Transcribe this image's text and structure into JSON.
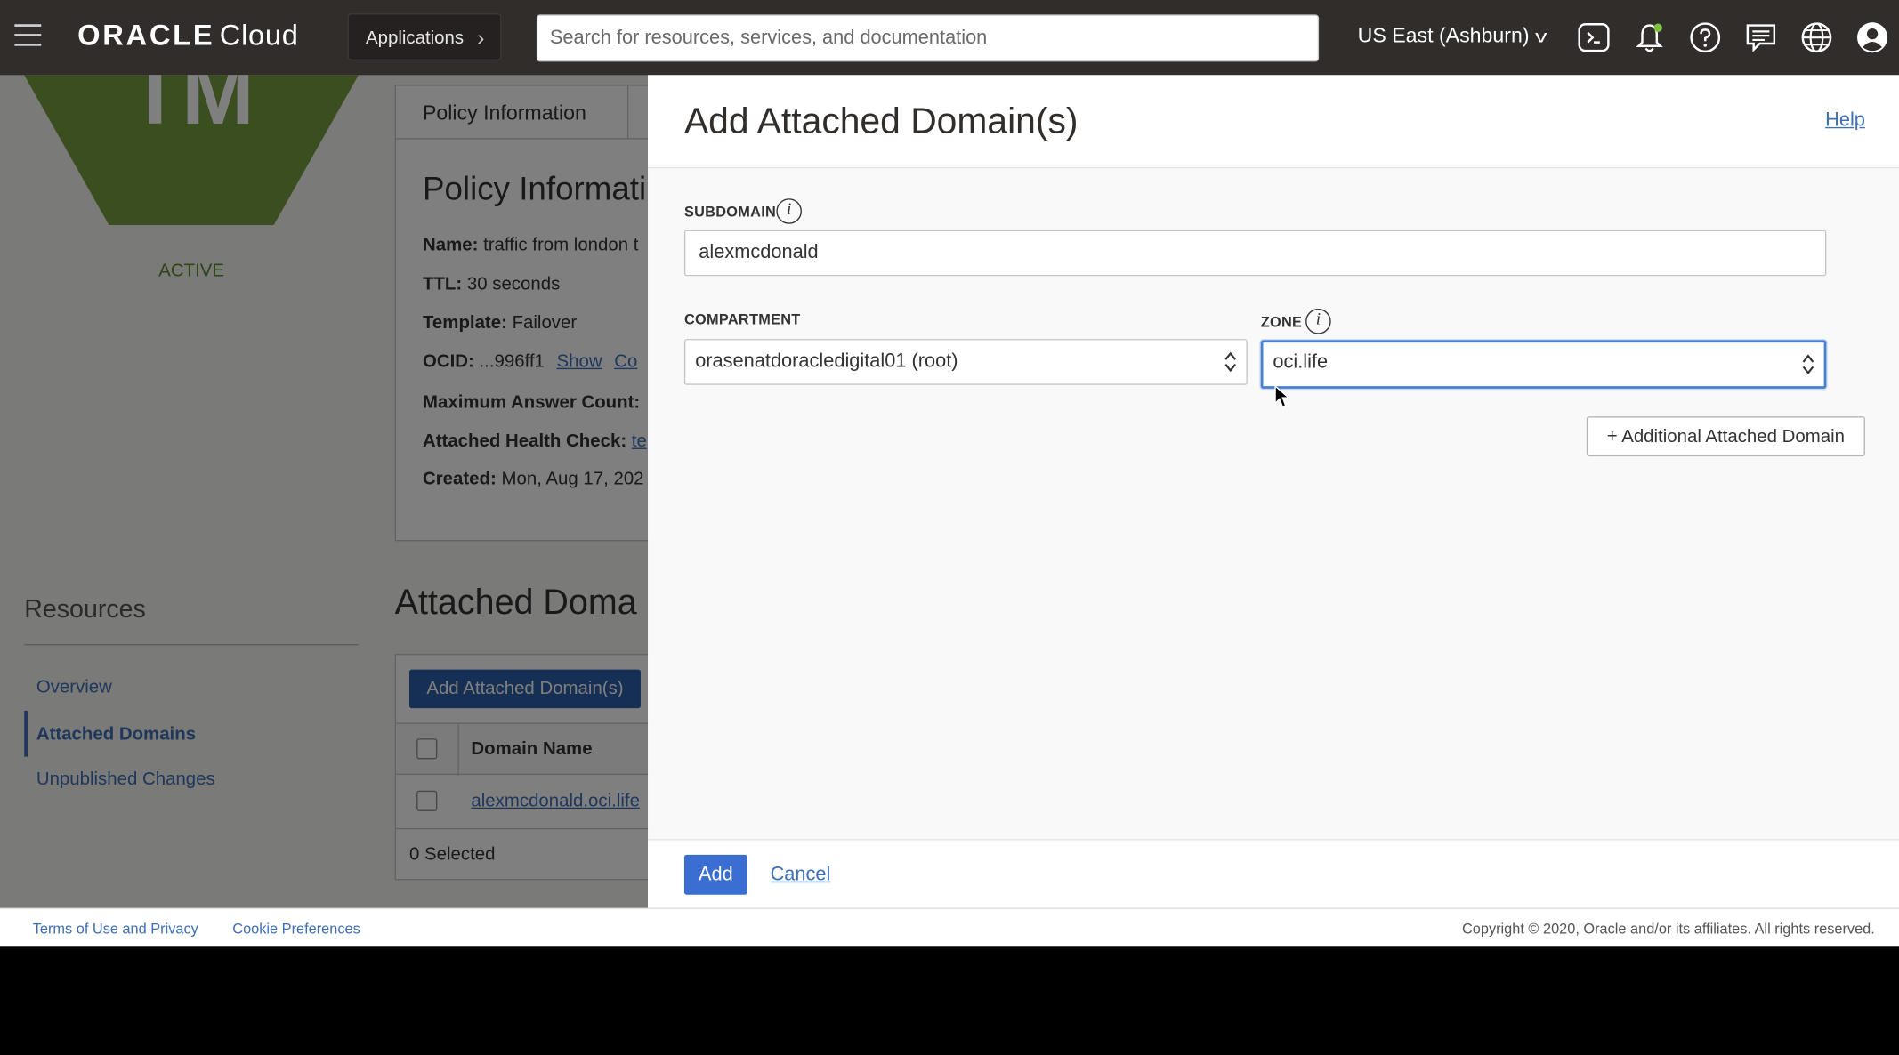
{
  "header": {
    "brand": "ORACLE",
    "brand_suffix": "Cloud",
    "applications_label": "Applications",
    "search_placeholder": "Search for resources, services, and documentation",
    "region": "US East (Ashburn)",
    "icons": [
      "cloud-shell-icon",
      "bell-icon",
      "help-icon",
      "chat-icon",
      "globe-icon",
      "user-icon"
    ]
  },
  "background": {
    "badge_letters": "TM",
    "status": "ACTIVE",
    "policy_tab": "Policy Information",
    "policy_heading": "Policy Informati",
    "fields": [
      {
        "label": "Name:",
        "value": "traffic from london t"
      },
      {
        "label": "TTL:",
        "value": "30 seconds"
      },
      {
        "label": "Template:",
        "value": "Failover"
      },
      {
        "label": "OCID:",
        "value": "...996ff1"
      },
      {
        "label": "Maximum Answer Count:",
        "value": ""
      },
      {
        "label": "Attached Health Check:",
        "value": ""
      },
      {
        "label": "Created:",
        "value": "Mon, Aug 17, 202"
      }
    ],
    "ocid_show": "Show",
    "ocid_copy": "Co",
    "health_check_link": "te",
    "resources_heading": "Resources",
    "resources": [
      "Overview",
      "Attached Domains",
      "Unpublished Changes"
    ],
    "attached_heading": "Attached Doma",
    "add_button": "Add Attached Domain(s)",
    "col_domain": "Domain Name",
    "rows": [
      "alexmcdonald.oci.life"
    ],
    "selected": "0 Selected"
  },
  "panel": {
    "title": "Add Attached Domain(s)",
    "help": "Help",
    "subdomain_label": "SUBDOMAIN",
    "subdomain_value": "alexmcdonald",
    "compartment_label": "COMPARTMENT",
    "compartment_value": "orasenatdoracledigital01 (root)",
    "zone_label": "ZONE",
    "zone_value": "oci.life",
    "add_more": "+ Additional Attached Domain",
    "add": "Add",
    "cancel": "Cancel"
  },
  "footer": {
    "terms": "Terms of Use and Privacy",
    "cookies": "Cookie Preferences",
    "copyright": "Copyright © 2020, Oracle and/or its affiliates. All rights reserved."
  },
  "colors": {
    "topbar": "#312d2a",
    "brand_green": "#759c3e",
    "link_blue": "#3d6fb5",
    "primary_button": "#3a6fd1"
  }
}
